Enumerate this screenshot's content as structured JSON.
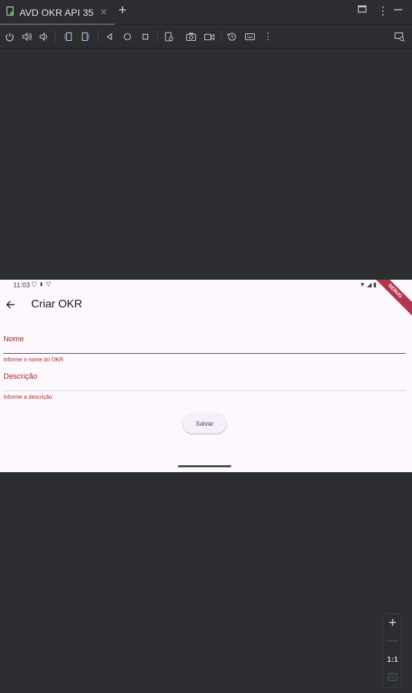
{
  "tab": {
    "title": "AVD OKR API 35",
    "close_icon": "close-icon",
    "add_icon": "plus-icon"
  },
  "window_controls": [
    "maximize-icon",
    "more-vertical-icon",
    "minimize-icon"
  ],
  "toolbar": {
    "icons": [
      "power-icon",
      "volume-up-icon",
      "volume-down-icon",
      "rotate-left-icon",
      "rotate-right-icon",
      "back-triangle-icon",
      "home-circle-icon",
      "overview-square-icon",
      "device-settings-icon",
      "camera-icon",
      "video-record-icon",
      "snapshot-restore-icon",
      "keyboard-icon",
      "more-vertical-icon",
      "device-mirror-icon"
    ]
  },
  "device": {
    "status_bar": {
      "time": "11:03"
    },
    "debug_banner": "DEBUG",
    "app_bar": {
      "title": "Criar OKR"
    },
    "form": {
      "nome": {
        "label": "Nome",
        "value": "",
        "helper": "Informe o nome do OKR"
      },
      "descricao": {
        "label": "Descrição",
        "value": "",
        "helper": "Informe a descrição"
      },
      "save_label": "Salvar"
    }
  },
  "zoom_panel": {
    "one_to_one": "1:1"
  },
  "colors": {
    "ide_bg": "#2b2d30",
    "device_bg": "#fdf7fe",
    "error": "#9a2a2a",
    "debug_ribbon": "#b3364d"
  }
}
